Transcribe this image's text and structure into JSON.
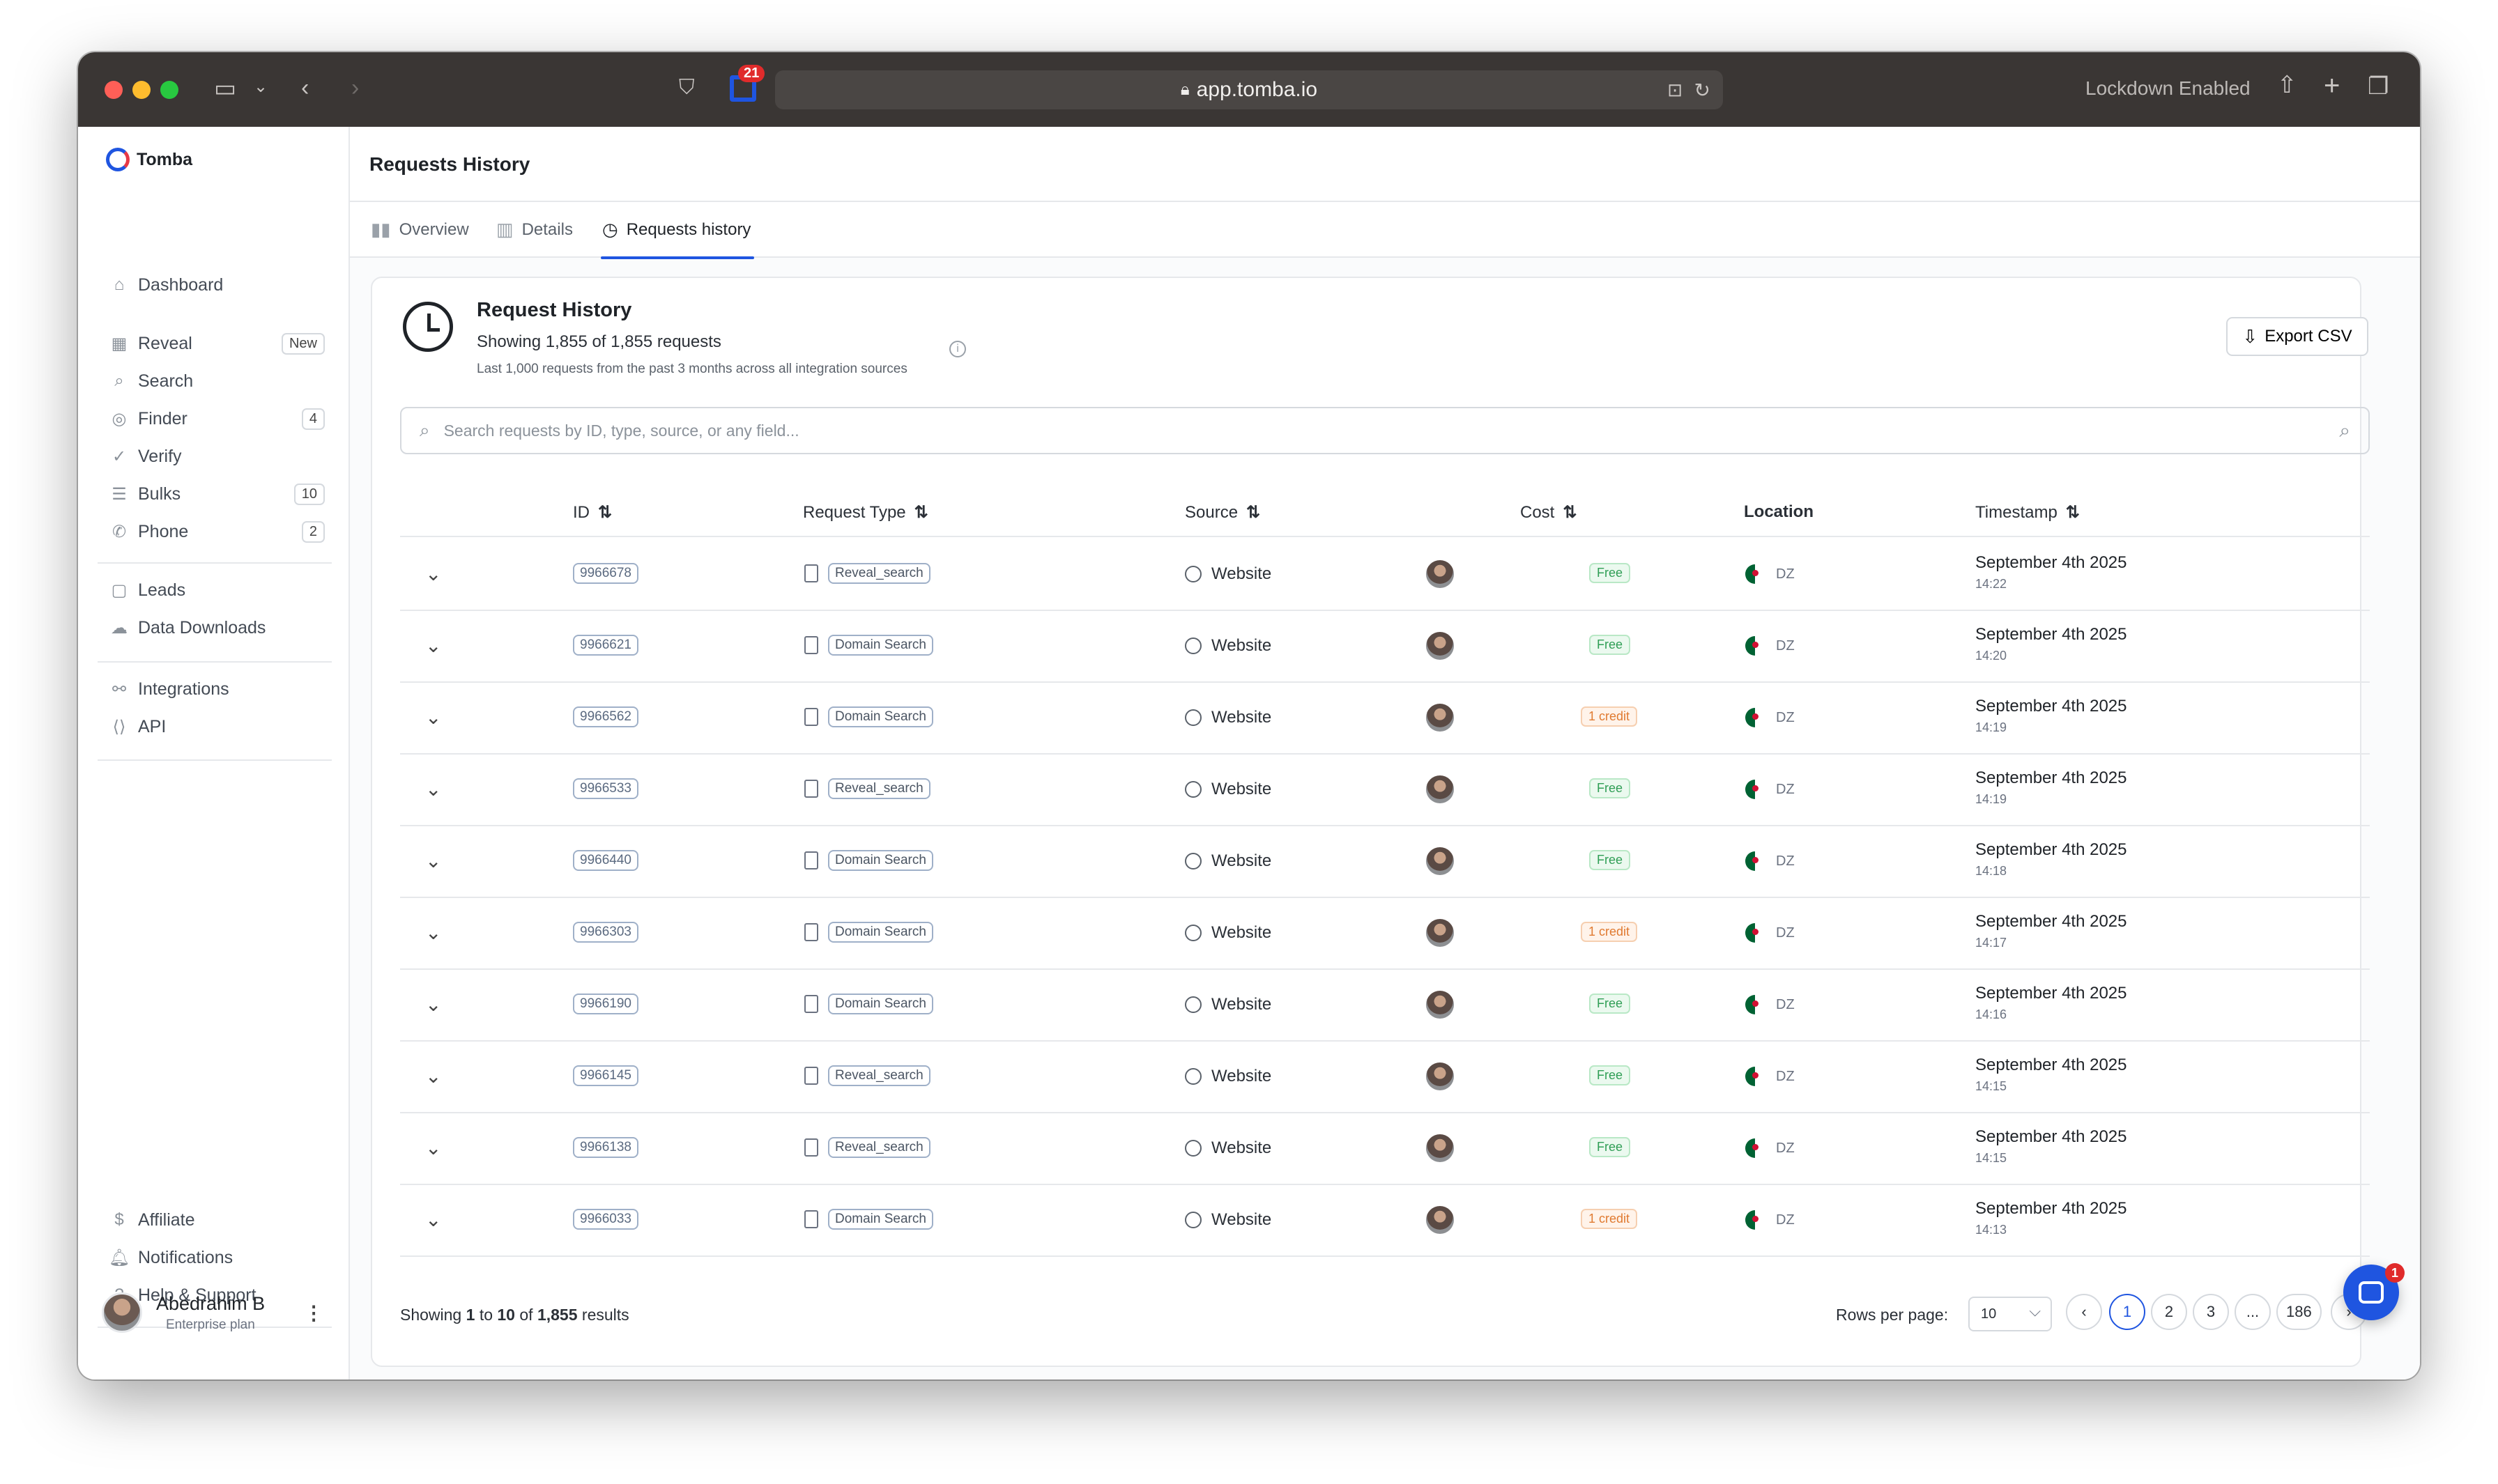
{
  "browser": {
    "url": "app.tomba.io",
    "lockdown": "Lockdown Enabled",
    "extension_badge": "21"
  },
  "sidebar": {
    "brand": "Tomba",
    "groups": [
      [
        {
          "label": "Dashboard",
          "icon": "home-icon",
          "count": ""
        }
      ],
      [
        {
          "label": "Reveal",
          "icon": "building-icon",
          "count": "New"
        },
        {
          "label": "Search",
          "icon": "search-icon",
          "count": ""
        },
        {
          "label": "Finder",
          "icon": "user-circle-icon",
          "count": "4"
        },
        {
          "label": "Verify",
          "icon": "check-circle-icon",
          "count": ""
        },
        {
          "label": "Bulks",
          "icon": "list-icon",
          "count": "10"
        },
        {
          "label": "Phone",
          "icon": "phone-icon",
          "count": "2"
        }
      ],
      [
        {
          "label": "Leads",
          "icon": "file-icon",
          "count": ""
        },
        {
          "label": "Data Downloads",
          "icon": "cloud-icon",
          "count": ""
        }
      ],
      [
        {
          "label": "Integrations",
          "icon": "plug-icon",
          "count": ""
        },
        {
          "label": "API",
          "icon": "code-icon",
          "count": ""
        }
      ]
    ],
    "bottom": [
      {
        "label": "Affiliate",
        "icon": "dollar-icon"
      },
      {
        "label": "Notifications",
        "icon": "bell-icon"
      },
      {
        "label": "Help & Support",
        "icon": "help-icon"
      }
    ],
    "user": {
      "name": "Abedrahim B",
      "plan": "Enterprise plan"
    }
  },
  "header": {
    "title": "Requests History"
  },
  "tabs": [
    {
      "label": "Overview",
      "icon": "bar-chart-icon"
    },
    {
      "label": "Details",
      "icon": "chart-icon"
    },
    {
      "label": "Requests history",
      "icon": "clock-icon"
    }
  ],
  "card": {
    "title": "Request History",
    "subtitle": "Showing 1,855 of 1,855 requests",
    "note": "Last 1,000 requests from the past 3 months across all integration sources",
    "export_label": "Export CSV",
    "search_placeholder": "Search requests by ID, type, source, or any field..."
  },
  "table": {
    "columns": {
      "id": "ID",
      "type": "Request Type",
      "source": "Source",
      "cost": "Cost",
      "location": "Location",
      "timestamp": "Timestamp"
    },
    "rows": [
      {
        "id": "9966678",
        "type": "Reveal_search",
        "source": "Website",
        "cost": "Free",
        "cost_kind": "free",
        "country": "DZ",
        "date": "September 4th 2025",
        "time": "14:22"
      },
      {
        "id": "9966621",
        "type": "Domain Search",
        "source": "Website",
        "cost": "Free",
        "cost_kind": "free",
        "country": "DZ",
        "date": "September 4th 2025",
        "time": "14:20"
      },
      {
        "id": "9966562",
        "type": "Domain Search",
        "source": "Website",
        "cost": "1 credit",
        "cost_kind": "credit",
        "country": "DZ",
        "date": "September 4th 2025",
        "time": "14:19"
      },
      {
        "id": "9966533",
        "type": "Reveal_search",
        "source": "Website",
        "cost": "Free",
        "cost_kind": "free",
        "country": "DZ",
        "date": "September 4th 2025",
        "time": "14:19"
      },
      {
        "id": "9966440",
        "type": "Domain Search",
        "source": "Website",
        "cost": "Free",
        "cost_kind": "free",
        "country": "DZ",
        "date": "September 4th 2025",
        "time": "14:18"
      },
      {
        "id": "9966303",
        "type": "Domain Search",
        "source": "Website",
        "cost": "1 credit",
        "cost_kind": "credit",
        "country": "DZ",
        "date": "September 4th 2025",
        "time": "14:17"
      },
      {
        "id": "9966190",
        "type": "Domain Search",
        "source": "Website",
        "cost": "Free",
        "cost_kind": "free",
        "country": "DZ",
        "date": "September 4th 2025",
        "time": "14:16"
      },
      {
        "id": "9966145",
        "type": "Reveal_search",
        "source": "Website",
        "cost": "Free",
        "cost_kind": "free",
        "country": "DZ",
        "date": "September 4th 2025",
        "time": "14:15"
      },
      {
        "id": "9966138",
        "type": "Reveal_search",
        "source": "Website",
        "cost": "Free",
        "cost_kind": "free",
        "country": "DZ",
        "date": "September 4th 2025",
        "time": "14:15"
      },
      {
        "id": "9966033",
        "type": "Domain Search",
        "source": "Website",
        "cost": "1 credit",
        "cost_kind": "credit",
        "country": "DZ",
        "date": "September 4th 2025",
        "time": "14:13"
      }
    ]
  },
  "footer": {
    "showing_prefix": "Showing",
    "from": "1",
    "to_word": "to",
    "to": "10",
    "of_word": "of",
    "total": "1,855",
    "results_word": "results",
    "rows_label": "Rows per page:",
    "rows_value": "10",
    "pages": [
      "1",
      "2",
      "3",
      "...",
      "186"
    ]
  },
  "chat": {
    "badge": "1"
  },
  "colors": {
    "accent": "#1f55e0",
    "free": "#2f9e55",
    "credit": "#e07a30"
  }
}
